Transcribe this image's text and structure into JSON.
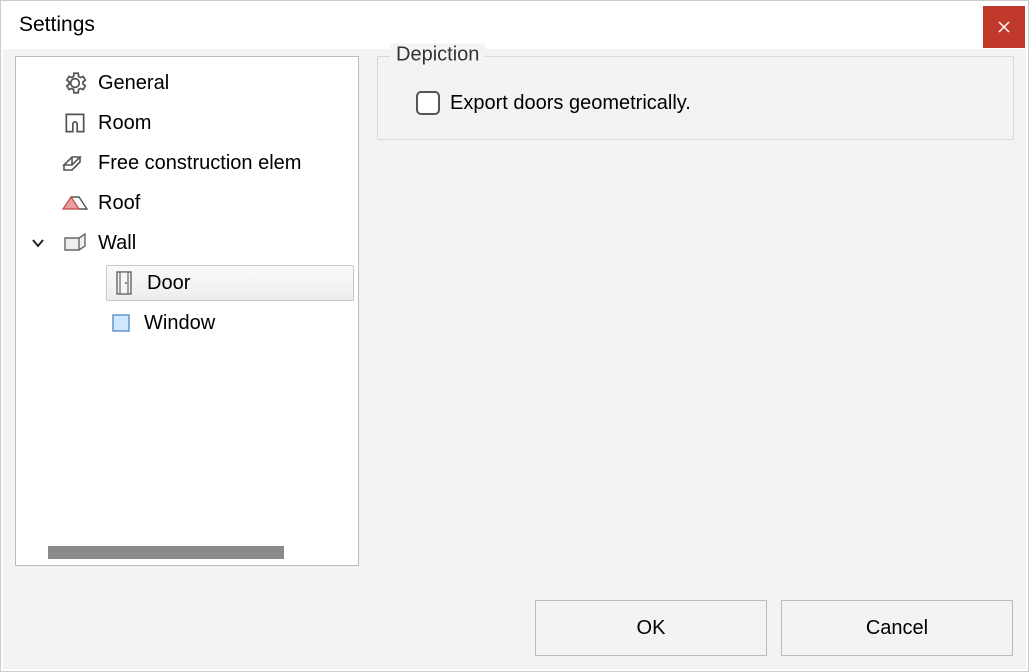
{
  "title": "Settings",
  "tree": {
    "items": [
      {
        "label": "General"
      },
      {
        "label": "Room"
      },
      {
        "label": "Free construction elem"
      },
      {
        "label": "Roof"
      },
      {
        "label": "Wall",
        "expanded": true,
        "children": [
          {
            "label": "Door",
            "selected": true
          },
          {
            "label": "Window"
          }
        ]
      }
    ]
  },
  "groupbox": {
    "title": "Depiction",
    "checkbox_label": "Export doors geometrically.",
    "checked": false
  },
  "buttons": {
    "ok": "OK",
    "cancel": "Cancel"
  }
}
